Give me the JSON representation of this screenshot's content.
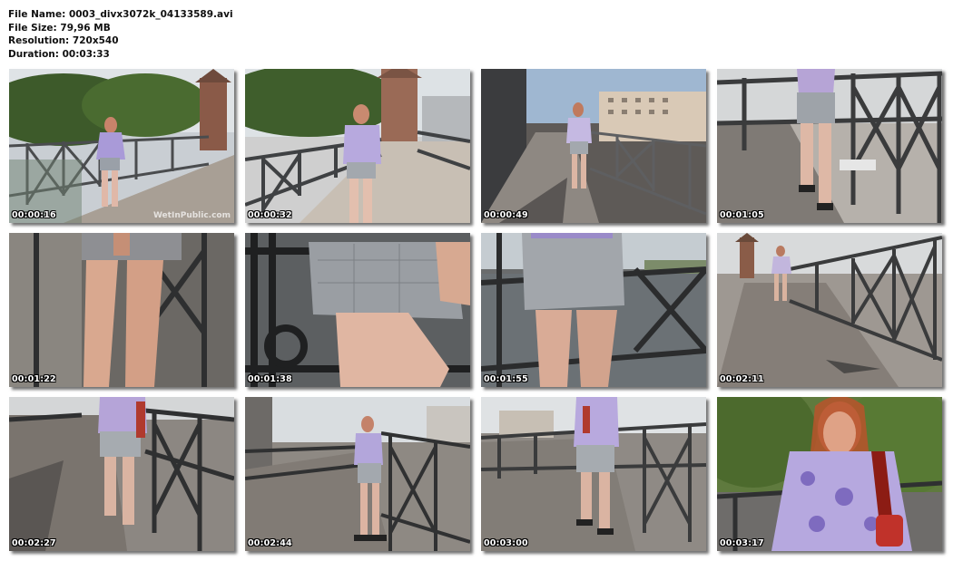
{
  "file_info": {
    "file_name": "File Name: 0003_divx3072k_04133589.avi",
    "file_size": "File Size: 79,96 MB",
    "resolution": "Resolution: 720x540",
    "duration": "Duration: 00:03:33"
  },
  "thumbnails": [
    {
      "timestamp": "00:00:16",
      "watermark": "WetInPublic.com"
    },
    {
      "timestamp": "00:00:32"
    },
    {
      "timestamp": "00:00:49"
    },
    {
      "timestamp": "00:01:05"
    },
    {
      "timestamp": "00:01:22"
    },
    {
      "timestamp": "00:01:38"
    },
    {
      "timestamp": "00:01:55"
    },
    {
      "timestamp": "00:02:11"
    },
    {
      "timestamp": "00:02:27"
    },
    {
      "timestamp": "00:02:44"
    },
    {
      "timestamp": "00:03:00"
    },
    {
      "timestamp": "00:03:17"
    }
  ]
}
